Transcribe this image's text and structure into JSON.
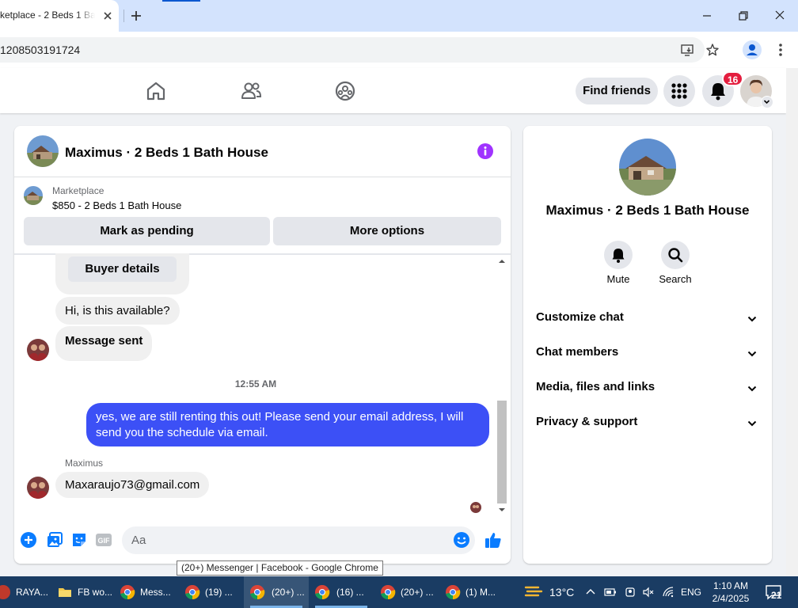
{
  "browser": {
    "tab_title": "ketplace - 2 Beds 1 Bat",
    "url": "1208503191724",
    "tooltip": "(20+) Messenger | Facebook - Google Chrome"
  },
  "nav": {
    "find_friends": "Find friends",
    "notification_count": "16"
  },
  "chat": {
    "title": "Maximus · 2 Beds 1 Bath House",
    "marketplace_label": "Marketplace",
    "listing": "$850 - 2 Beds 1 Bath House",
    "mark_pending": "Mark as pending",
    "more_options": "More options",
    "buyer_details": "Buyer details",
    "messages": {
      "available": "Hi, is this available?",
      "sent": "Message sent",
      "timestamp": "12:55 AM",
      "outgoing": "yes, we are still renting this out! Please send your email address, I will send you the schedule via email.",
      "sender_name": "Maximus",
      "email": "Maxaraujo73@gmail.com"
    },
    "composer": {
      "placeholder": "Aa",
      "gif": "GIF"
    }
  },
  "info_panel": {
    "title": "Maximus · 2 Beds 1 Bath House",
    "mute": "Mute",
    "search": "Search",
    "sections": [
      "Customize chat",
      "Chat members",
      "Media, files and links",
      "Privacy & support"
    ]
  },
  "taskbar": {
    "items": [
      {
        "label": "RAYA..."
      },
      {
        "label": "FB wo..."
      },
      {
        "label": "Mess..."
      },
      {
        "label": "(19) ..."
      },
      {
        "label": "(20+) ..."
      },
      {
        "label": "(16) ..."
      },
      {
        "label": "(20+) ..."
      },
      {
        "label": "(1) M..."
      }
    ],
    "temperature": "13°C",
    "language": "ENG",
    "time": "1:10 AM",
    "date": "2/4/2025",
    "notifications": "21"
  },
  "colors": {
    "accent_blue": "#3c50f6",
    "info_purple": "#a033ff",
    "notif_red": "#e41e3f",
    "messenger_blue": "#0a7cff"
  }
}
